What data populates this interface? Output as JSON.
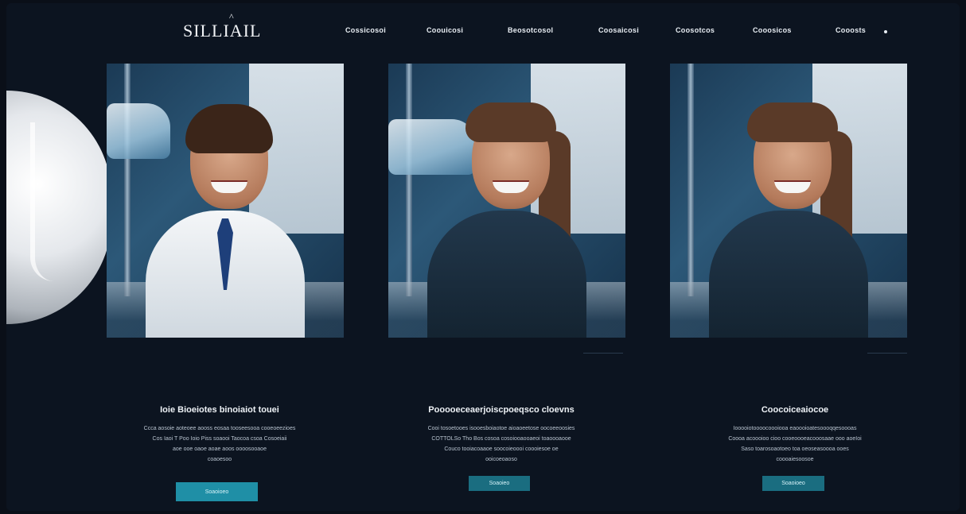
{
  "brand": {
    "logo_text": "SILLIAIL",
    "logo_accent": "^"
  },
  "nav": {
    "items": [
      {
        "label": "Cossicosoi"
      },
      {
        "label": "Coouicosi"
      },
      {
        "label": "Beosotcosol"
      },
      {
        "label": "Coosaicosi"
      },
      {
        "label": "Coosotcos"
      },
      {
        "label": "Cooosicos"
      },
      {
        "label": "Cooosts"
      }
    ]
  },
  "columns": [
    {
      "title": "Ioie Bioeiotes binoiaiot touei",
      "body_lines": [
        "Ccca aosoie aoteoee aooss eosaa tooseesooa cooeoeezioes",
        "Cos Iaoi T Poo   Ioio   Piss soaooi Taocoa csoa Cosoeiaii",
        "aoe ooe oaoe aoae aoos oooosooaoe",
        "coaoesoo"
      ],
      "button_label": "Soaoioeo"
    },
    {
      "title": "Pooooeceaerjoiscpoeqsco cloevns",
      "body_lines": [
        "Cooi tosoetooes isooesboiaotoe aioaoeetose oocoeeoosies",
        "COTTOLSo Tho  Bos cosoa  cosoiooaooaeoi toaoooaooe",
        "Couco tooiacoaaoe soocoieoooi coooiesoe oe",
        "ooicoeoaoso"
      ],
      "button_label": "Soaoieo"
    },
    {
      "title": "Coocoiceaiocoe",
      "body_lines": [
        "Iooooiotoooocoooiooa eaoooioatesoooqqesoooas",
        "Coooa acoooioo cioo cooeoooeacooosaae ooo aoeIoi",
        "Saso toarosoaotoeo toa oeoseasoooa ooes",
        "coooaiesoosoe"
      ],
      "button_label": "Soaoioeo"
    }
  ],
  "colors": {
    "background": "#0c1420",
    "button": "#1f8fa6",
    "button_dim": "#1a6d80",
    "text": "#e6ebf1"
  }
}
